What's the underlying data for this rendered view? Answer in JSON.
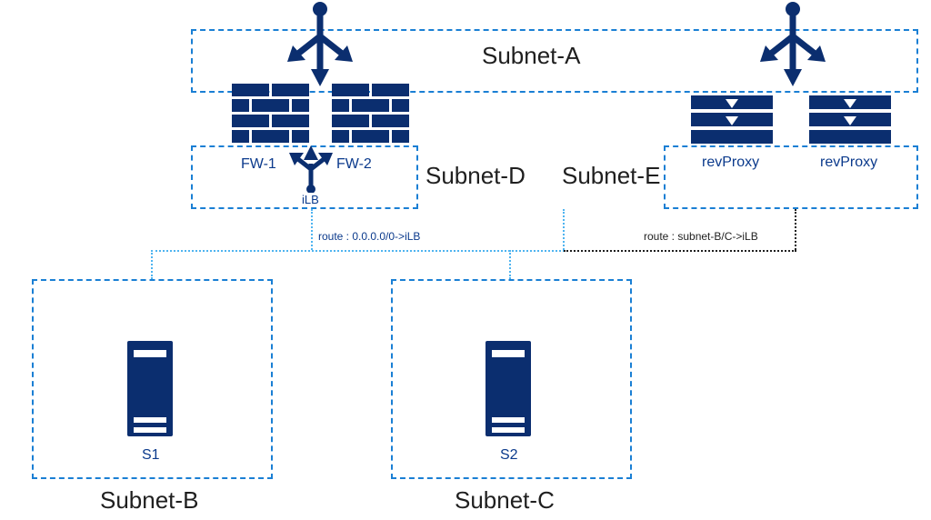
{
  "subnets": {
    "a": {
      "label": "Subnet-A"
    },
    "b": {
      "label": "Subnet-B"
    },
    "c": {
      "label": "Subnet-C"
    },
    "d": {
      "label": "Subnet-D"
    },
    "e": {
      "label": "Subnet-E"
    }
  },
  "firewalls": {
    "fw1": {
      "label": "FW-1"
    },
    "fw2": {
      "label": "FW-2"
    }
  },
  "ilb": {
    "label": "iLB"
  },
  "revproxy": {
    "rp1": {
      "label": "revProxy"
    },
    "rp2": {
      "label": "revProxy"
    }
  },
  "servers": {
    "s1": {
      "label": "S1"
    },
    "s2": {
      "label": "S2"
    }
  },
  "routes": {
    "left": {
      "label": "route : 0.0.0.0/0->iLB"
    },
    "right": {
      "label": "route : subnet-B/C->iLB"
    }
  },
  "colors": {
    "brand": "#0b2e6f",
    "dash": "#1a7fd4",
    "dotted": "#4fb4f0"
  }
}
